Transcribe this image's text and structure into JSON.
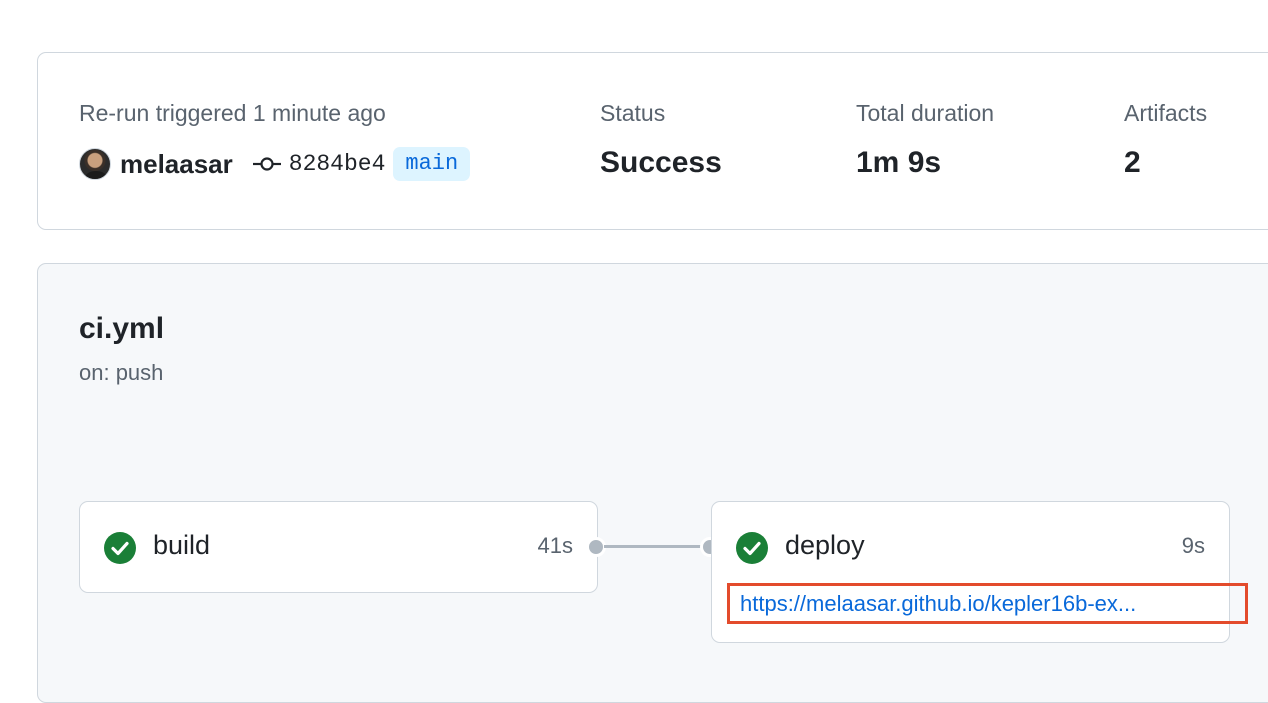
{
  "summary": {
    "trigger_label": "Re-run triggered 1 minute ago",
    "actor": "melaasar",
    "commit_sha": "8284be4",
    "branch": "main",
    "status_label": "Status",
    "status_value": "Success",
    "duration_label": "Total duration",
    "duration_value": "1m 9s",
    "artifacts_label": "Artifacts",
    "artifacts_value": "2"
  },
  "workflow": {
    "file": "ci.yml",
    "event": "on: push",
    "jobs": [
      {
        "name": "build",
        "duration": "41s",
        "status_icon": "check-circle-icon"
      },
      {
        "name": "deploy",
        "duration": "9s",
        "status_icon": "check-circle-icon",
        "link": "https://melaasar.github.io/kepler16b-ex..."
      }
    ]
  },
  "colors": {
    "success": "#1a7f37",
    "link": "#0969da",
    "highlight": "#e34b2c",
    "branch_bg": "#ddf4ff"
  }
}
